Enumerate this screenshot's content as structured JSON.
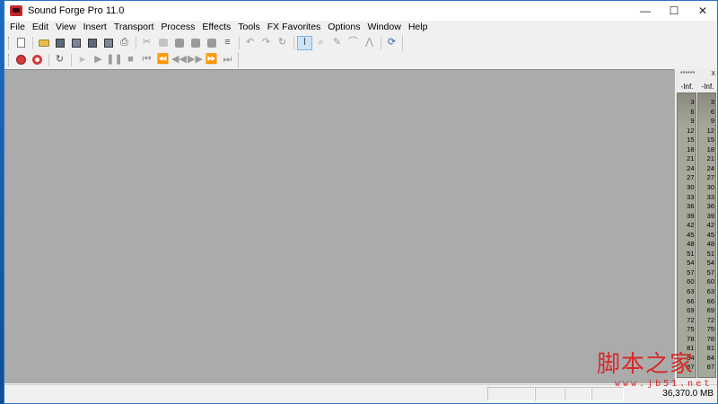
{
  "window": {
    "title": "Sound Forge Pro 11.0"
  },
  "window_controls": {
    "minimize": "—",
    "maximize": "☐",
    "close": "✕"
  },
  "menu": [
    "File",
    "Edit",
    "View",
    "Insert",
    "Transport",
    "Process",
    "Effects",
    "Tools",
    "FX Favorites",
    "Options",
    "Window",
    "Help"
  ],
  "toolbar1": {
    "groups": [
      [
        "new-document-icon"
      ],
      [
        "open-folder-icon",
        "save-icon",
        "save-as-icon",
        "save-all-icon",
        "render-icon",
        "print-icon"
      ],
      [
        "cut-icon",
        "copy-icon",
        "paste-icon",
        "paste-mix-icon",
        "paste-crossfade-icon",
        "trim-icon"
      ],
      [
        "undo-icon",
        "redo-icon",
        "repeat-icon"
      ],
      [
        "edit-tool-icon",
        "magnify-tool-icon",
        "pencil-tool-icon",
        "envelope-tool-icon",
        "event-tool-icon"
      ],
      [
        "refresh-icon"
      ]
    ],
    "active": "edit-tool-icon"
  },
  "toolbar2": {
    "groups": [
      [
        "record-icon",
        "record-arm-icon"
      ],
      [
        "loop-icon"
      ],
      [
        "play-all-icon",
        "play-icon",
        "pause-icon",
        "stop-icon",
        "go-to-start-icon",
        "rewind-icon",
        "fast-rewind-icon",
        "fast-forward-icon",
        "forward-icon",
        "go-to-end-icon"
      ]
    ]
  },
  "meter_panel": {
    "title_dots": "******",
    "close": "x",
    "peak_left": "-Inf.",
    "peak_right": "-Inf.",
    "scale": [
      "3",
      "6",
      "9",
      "12",
      "15",
      "18",
      "21",
      "24",
      "27",
      "30",
      "33",
      "36",
      "39",
      "42",
      "45",
      "48",
      "51",
      "54",
      "57",
      "60",
      "63",
      "66",
      "69",
      "72",
      "75",
      "78",
      "81",
      "84",
      "87"
    ]
  },
  "status": {
    "free_space": "36,370.0 MB"
  },
  "watermark": {
    "text": "脚本之家",
    "sub": "www.jb51.net"
  }
}
